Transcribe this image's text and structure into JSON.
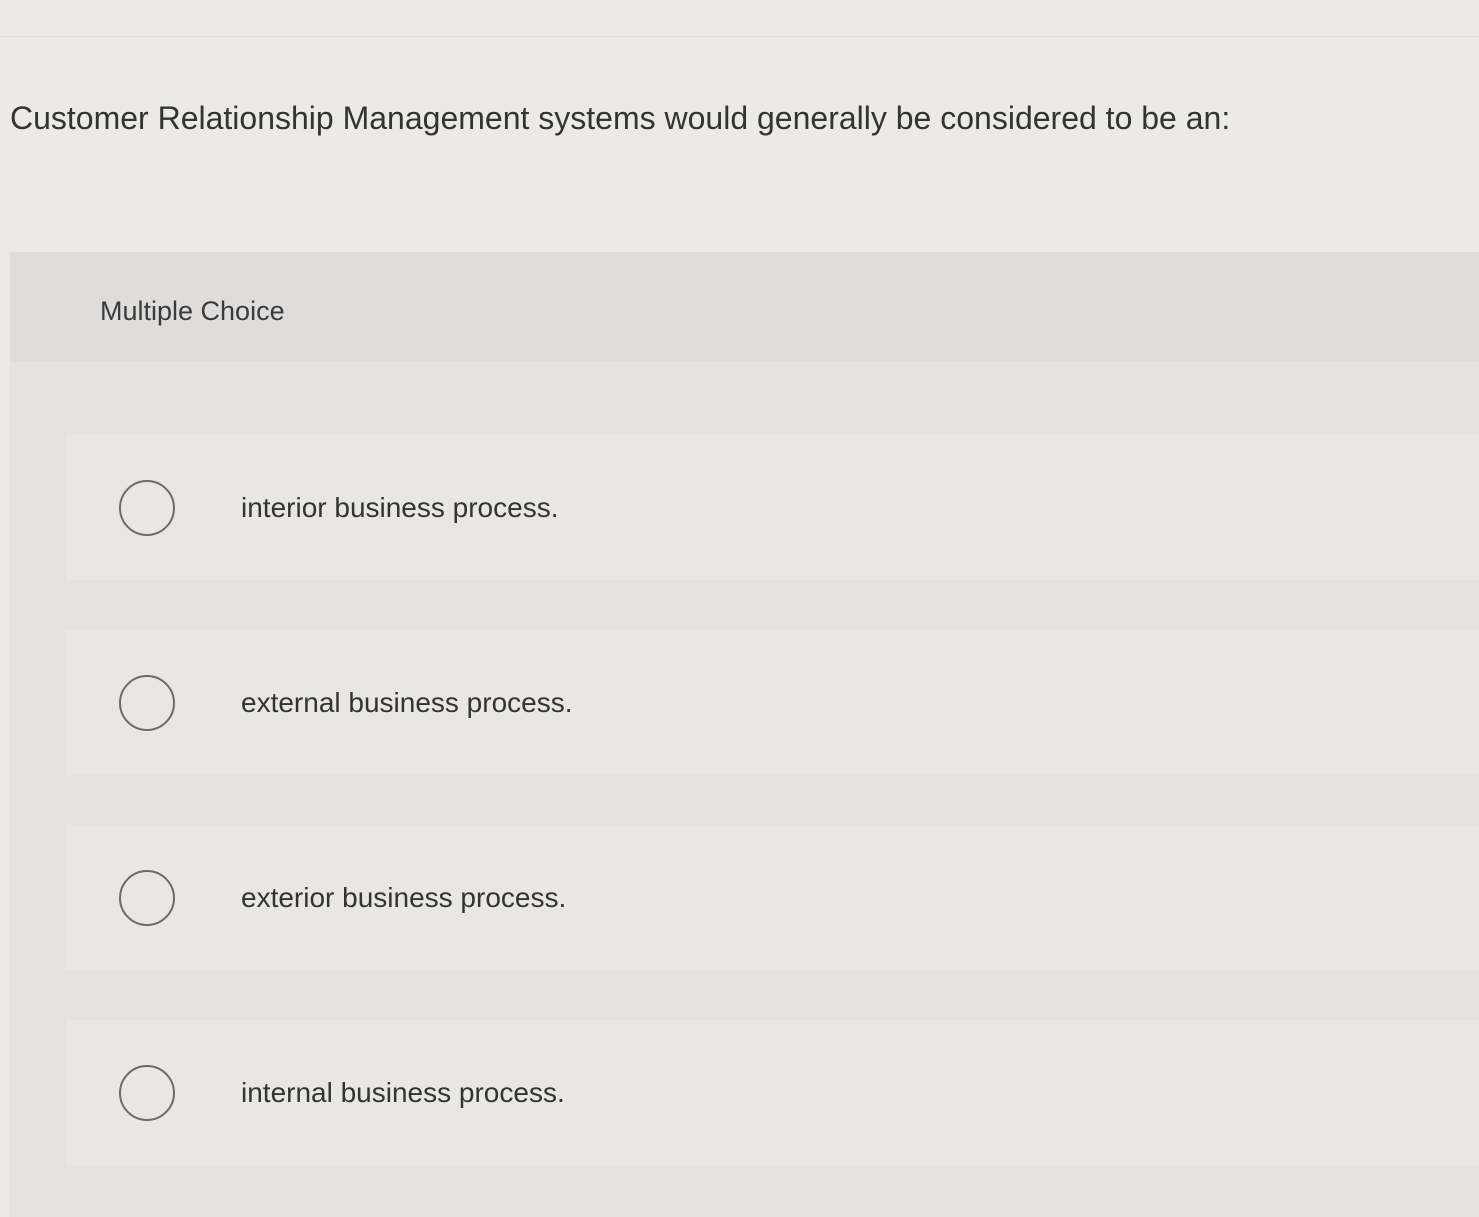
{
  "question": {
    "text": "Customer Relationship Management systems would generally be considered to be an:"
  },
  "answer_panel": {
    "label": "Multiple Choice",
    "options": [
      {
        "label": "interior business process.",
        "selected": false
      },
      {
        "label": "external business process.",
        "selected": false
      },
      {
        "label": "exterior business process.",
        "selected": false
      },
      {
        "label": "internal business process.",
        "selected": false
      }
    ]
  },
  "colors": {
    "background": "#ebeae6",
    "panel": "#e4e3df",
    "text": "#333333",
    "radio_border": "#6b6b6b"
  }
}
